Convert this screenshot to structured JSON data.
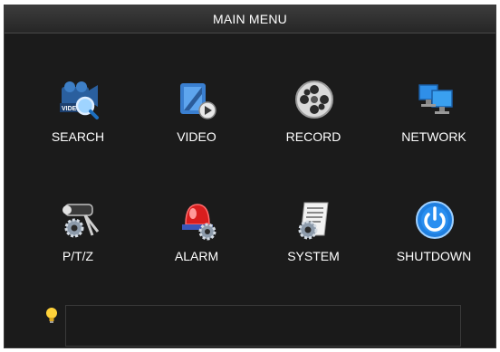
{
  "window": {
    "title": "MAIN MENU"
  },
  "menu": [
    {
      "key": "search",
      "label": "SEARCH",
      "icon": "video-search-icon"
    },
    {
      "key": "video",
      "label": "VIDEO",
      "icon": "video-clip-icon"
    },
    {
      "key": "record",
      "label": "RECORD",
      "icon": "film-reel-icon"
    },
    {
      "key": "network",
      "label": "NETWORK",
      "icon": "network-monitors-icon"
    },
    {
      "key": "ptz",
      "label": "P/T/Z",
      "icon": "camera-gear-icon"
    },
    {
      "key": "alarm",
      "label": "ALARM",
      "icon": "alarm-siren-gear-icon"
    },
    {
      "key": "system",
      "label": "SYSTEM",
      "icon": "document-gear-icon"
    },
    {
      "key": "shutdown",
      "label": "SHUTDOWN",
      "icon": "power-icon"
    }
  ],
  "status": {
    "hint_icon": "lightbulb-icon",
    "message": ""
  },
  "colors": {
    "background": "#1b1b1b",
    "text": "#ffffff",
    "accent": "#2f8fe8"
  }
}
